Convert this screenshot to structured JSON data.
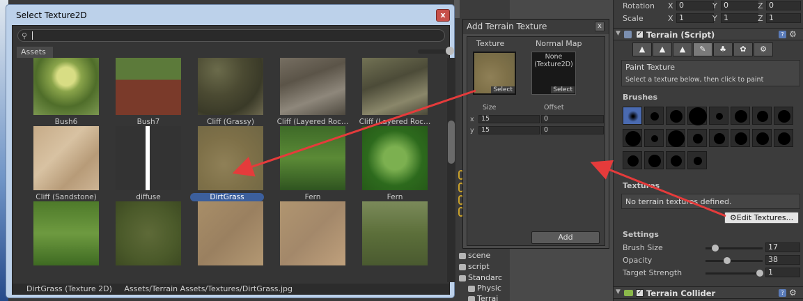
{
  "select_window": {
    "title": "Select Texture2D",
    "close": "x",
    "search_placeholder": "",
    "tab": "Assets",
    "textures": [
      {
        "label": "Bush6",
        "cls": "t-bush6"
      },
      {
        "label": "Bush7",
        "cls": "t-bush7"
      },
      {
        "label": "Cliff (Grassy)",
        "cls": "t-cliffg"
      },
      {
        "label": "Cliff (Layered Roc…",
        "cls": "t-cliffl1"
      },
      {
        "label": "Cliff (Layered Roc…",
        "cls": "t-cliffl2"
      },
      {
        "label": "Cliff (Sandstone)",
        "cls": "t-sand"
      },
      {
        "label": "diffuse",
        "cls": "t-diffuse"
      },
      {
        "label": "DirtGrass",
        "cls": "t-dirt",
        "selected": true
      },
      {
        "label": "Fern",
        "cls": "t-fern1"
      },
      {
        "label": "Fern",
        "cls": "t-fern2"
      },
      {
        "label": "",
        "cls": "t-fern3"
      },
      {
        "label": "",
        "cls": "t-grass"
      },
      {
        "label": "",
        "cls": "t-sand2"
      },
      {
        "label": "",
        "cls": "t-sand3"
      },
      {
        "label": "",
        "cls": "t-reeds"
      }
    ],
    "status": "DirtGrass (Texture 2D)     Assets/Terrain Assets/Textures/DirtGrass.jpg"
  },
  "add_window": {
    "title": "Add Terrain Texture",
    "close": "x",
    "texture_label": "Texture",
    "normal_map_label": "Normal Map",
    "select": "Select",
    "normal_none": "None\n(Texture2D)",
    "size_label": "Size",
    "offset_label": "Offset",
    "x_label": "x",
    "y_label": "y",
    "size_x": "15",
    "size_y": "15",
    "offset_x": "0",
    "offset_y": "0",
    "add": "Add"
  },
  "hierarchy": {
    "items": [
      "scene",
      "script",
      "Standarc",
      "Physic",
      "Terrai"
    ]
  },
  "inspector": {
    "rotation_label": "Rotation",
    "scale_label": "Scale",
    "rotation": {
      "x": "0",
      "y": "0",
      "z": "0"
    },
    "scale": {
      "x": "1",
      "y": "1",
      "z": "1"
    },
    "axis_x": "X",
    "axis_y": "Y",
    "axis_z": "Z",
    "terrain_title": "Terrain (Script)",
    "paint_title": "Paint Texture",
    "paint_hint": "Select a texture below, then click to paint",
    "brushes_label": "Brushes",
    "textures_label": "Textures",
    "no_textures": "No terrain textures defined.",
    "edit_textures": "Edit Textures...",
    "settings_label": "Settings",
    "brush_size_label": "Brush Size",
    "brush_size": "17",
    "opacity_label": "Opacity",
    "opacity": "38",
    "target_strength_label": "Target Strength",
    "target_strength": "1",
    "collider_title": "Terrain Collider"
  },
  "colors": {
    "accent_selected": "#3c5f9c",
    "arrow": "#e53b3b"
  }
}
